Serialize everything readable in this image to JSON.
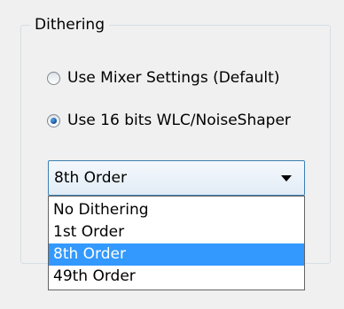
{
  "group": {
    "title": "Dithering"
  },
  "radios": [
    {
      "label": "Use Mixer Settings (Default)",
      "checked": false
    },
    {
      "label": "Use 16 bits WLC/NoiseShaper",
      "checked": true
    }
  ],
  "combo": {
    "value": "8th Order",
    "options": [
      "No Dithering",
      "1st Order",
      "8th Order",
      "49th Order"
    ],
    "highlighted": "8th Order"
  },
  "colors": {
    "highlight": "#3399ff",
    "combo_border": "#3c7fb1",
    "group_border": "#d5dfe5"
  }
}
